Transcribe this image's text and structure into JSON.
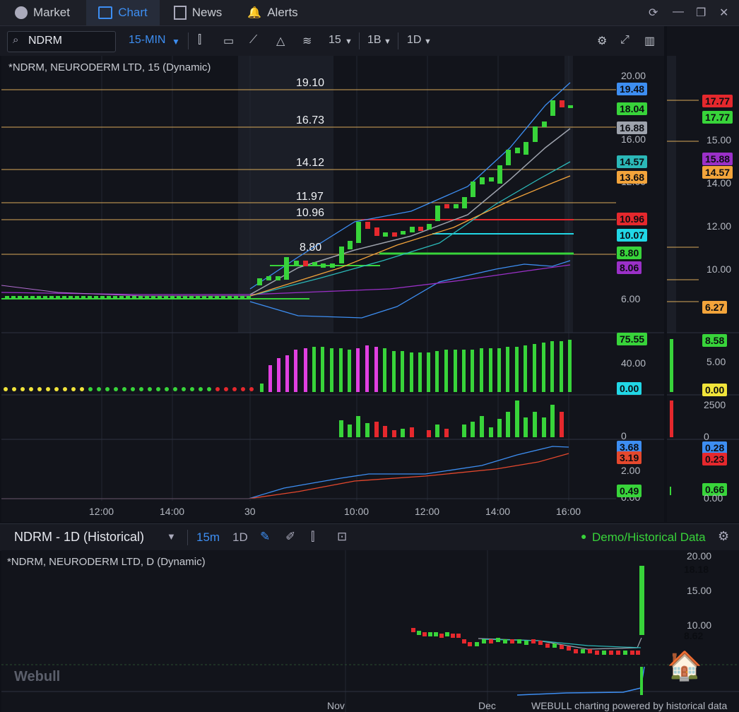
{
  "nav": {
    "tabs": [
      {
        "label": "Market",
        "icon": "market-icon"
      },
      {
        "label": "Chart",
        "icon": "chart-icon"
      },
      {
        "label": "News",
        "icon": "news-icon"
      },
      {
        "label": "Alerts",
        "icon": "bell-icon"
      }
    ]
  },
  "toolbar": {
    "symbol": "NDRM",
    "interval": "15-MIN",
    "num_option": "15",
    "option_1b": "1B",
    "option_1d": "1D"
  },
  "chart": {
    "title": "*NDRM, NEURODERM LTD, 15 (Dynamic)",
    "price_levels": [
      "19.10",
      "16.73",
      "14.12",
      "11.97",
      "10.96",
      "8.80"
    ],
    "axis_labels": [
      "20.00",
      "16.00",
      "12.00",
      "6.00",
      "40.00",
      "0",
      "2.00",
      "0.00"
    ],
    "tags": [
      {
        "value": "19.48",
        "color": "#3d8ef2"
      },
      {
        "value": "18.04",
        "color": "#38d43a"
      },
      {
        "value": "16.88",
        "color": "#9ea3ad"
      },
      {
        "value": "14.57",
        "color": "#2bb8b8"
      },
      {
        "value": "13.68",
        "color": "#f3a43b"
      },
      {
        "value": "10.96",
        "color": "#e5282d"
      },
      {
        "value": "10.07",
        "color": "#21d7e6"
      },
      {
        "value": "8.80",
        "color": "#38d43a"
      },
      {
        "value": "8.06",
        "color": "#9b30c8"
      },
      {
        "value": "75.55",
        "color": "#38d43a"
      },
      {
        "value": "0.00",
        "color": "#21d7e6"
      },
      {
        "value": "3.68",
        "color": "#3d8ef2"
      },
      {
        "value": "3.19",
        "color": "#e5482d"
      },
      {
        "value": "0.49",
        "color": "#38d43a"
      }
    ],
    "time_labels": [
      "12:00",
      "14:00",
      "30",
      "10:00",
      "12:00",
      "14:00",
      "16:00"
    ]
  },
  "right_pane": {
    "tags": [
      {
        "value": "17.77",
        "color": "#e5282d"
      },
      {
        "value": "17.77",
        "color": "#38d43a"
      },
      {
        "value": "15.88",
        "color": "#9b30c8"
      },
      {
        "value": "14.57",
        "color": "#f3a43b"
      },
      {
        "value": "6.27",
        "color": "#f3a43b"
      },
      {
        "value": "8.58",
        "color": "#38d43a"
      },
      {
        "value": "0.00",
        "color": "#f1e43a"
      },
      {
        "value": "0.28",
        "color": "#3d8ef2"
      },
      {
        "value": "0.23",
        "color": "#e5282d"
      },
      {
        "value": "0.66",
        "color": "#38d43a"
      }
    ],
    "axis_labels": [
      "15.00",
      "14.00",
      "12.00",
      "10.00",
      "5.00",
      "2500",
      "0",
      "0.00"
    ]
  },
  "bottom": {
    "title": "NDRM - 1D (Historical)",
    "intervals": [
      "15m",
      "1D"
    ],
    "status": "Demo/Historical Data",
    "chart_title": "*NDRM, NEURODERM LTD, D (Dynamic)",
    "axis_labels": [
      "20.00",
      "15.00",
      "10.00"
    ],
    "tags": [
      {
        "value": "18.18",
        "color": "#38d43a"
      },
      {
        "value": "8.62",
        "color": "#cfd2d8"
      }
    ],
    "months": [
      "Nov",
      "Dec"
    ],
    "watermark": "Webull",
    "footer": "WEBULL charting powered by historical data"
  }
}
